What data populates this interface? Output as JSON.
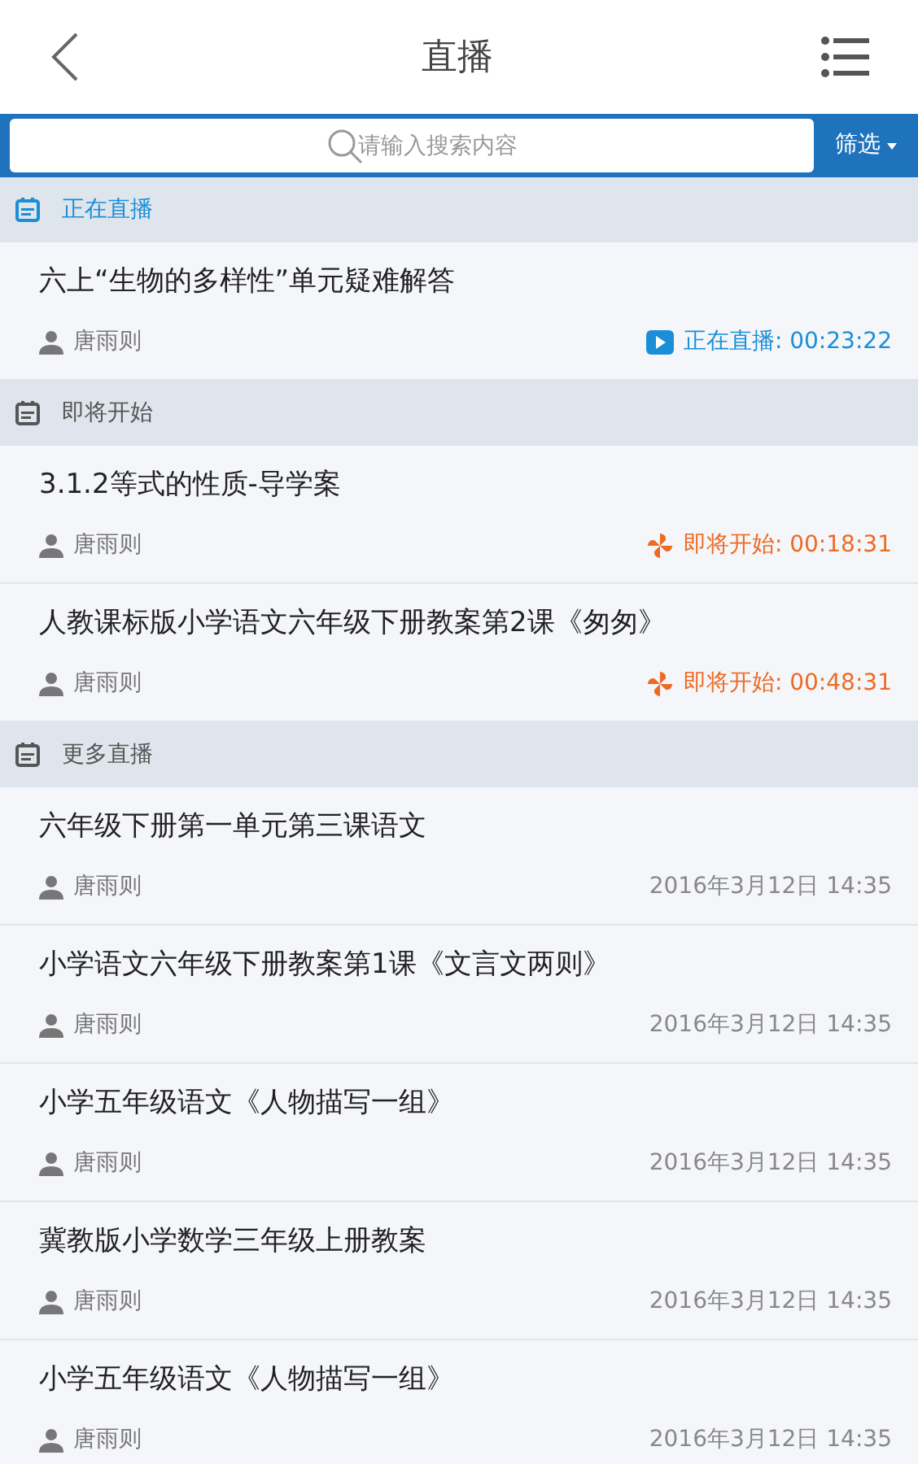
{
  "header": {
    "title": "直播"
  },
  "search": {
    "placeholder": "请输入搜索内容",
    "filter": "筛选"
  },
  "sections": [
    {
      "title": "正在直播",
      "highlighted": true,
      "items": [
        {
          "title": "六上“生物的多样性”单元疑难解答",
          "author": "唐雨则",
          "kind": "live",
          "status": "正在直播: 00:23:22"
        }
      ]
    },
    {
      "title": "即将开始",
      "highlighted": false,
      "items": [
        {
          "title": "3.1.2等式的性质-导学案",
          "author": "唐雨则",
          "kind": "upcoming",
          "status": "即将开始: 00:18:31"
        },
        {
          "title": "人教课标版小学语文六年级下册教案第2课《匆匆》",
          "author": "唐雨则",
          "kind": "upcoming",
          "status": "即将开始: 00:48:31"
        }
      ]
    },
    {
      "title": "更多直播",
      "highlighted": false,
      "items": [
        {
          "title": "六年级下册第一单元第三课语文",
          "author": "唐雨则",
          "kind": "date",
          "status": "2016年3月12日 14:35"
        },
        {
          "title": "小学语文六年级下册教案第1课《文言文两则》",
          "author": "唐雨则",
          "kind": "date",
          "status": "2016年3月12日 14:35"
        },
        {
          "title": "小学五年级语文《人物描写一组》",
          "author": "唐雨则",
          "kind": "date",
          "status": "2016年3月12日 14:35"
        },
        {
          "title": "冀教版小学数学三年级上册教案",
          "author": "唐雨则",
          "kind": "date",
          "status": "2016年3月12日 14:35"
        },
        {
          "title": "小学五年级语文《人物描写一组》",
          "author": "唐雨则",
          "kind": "date",
          "status": "2016年3月12日 14:35"
        }
      ]
    }
  ]
}
